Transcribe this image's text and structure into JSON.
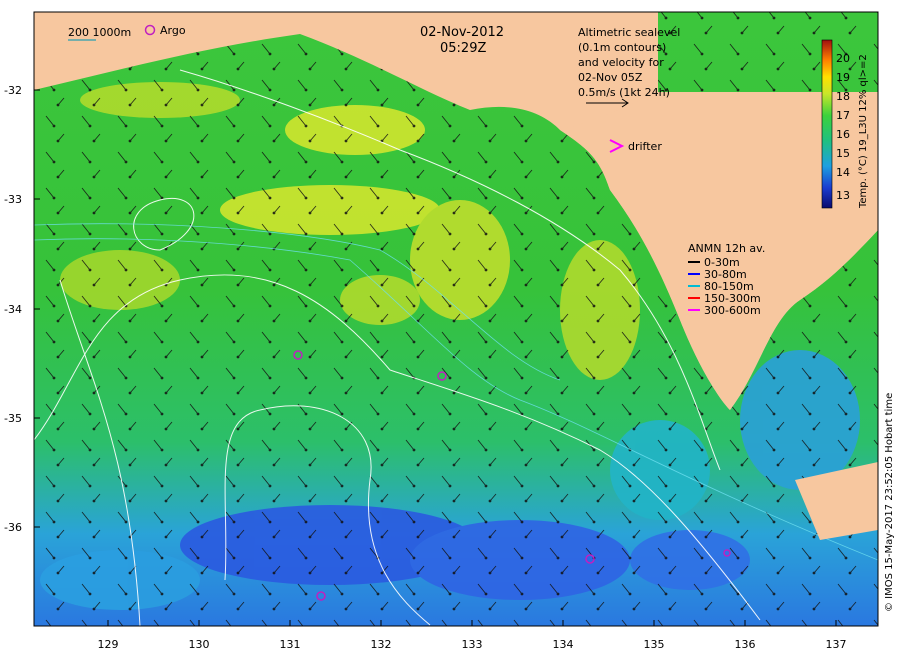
{
  "map": {
    "date": "02-Nov-2012",
    "time": "05:29Z",
    "scale_label": "200  1000m",
    "argo_label": "Argo",
    "altimetry_lines": [
      "Altimetric sealevel",
      "(0.1m contours)",
      "and velocity for",
      "02-Nov 05Z"
    ],
    "vector_scale_label": "0.5m/s (1kt 24h)",
    "drifter_label": "drifter",
    "credit": "© IMOS 15-May-2017 23:52:05 Hobart time",
    "y_ticks": [
      "-32",
      "-33",
      "-34",
      "-35",
      "-36"
    ],
    "x_ticks": [
      "129",
      "130",
      "131",
      "132",
      "133",
      "134",
      "135",
      "136",
      "137"
    ],
    "colorbar": {
      "title": "Temp. (°C) 19_L3U 12% ql>=2",
      "ticks": [
        "20",
        "19",
        "18",
        "17",
        "16",
        "15",
        "14",
        "13"
      ]
    },
    "anmn_legend": {
      "title": "ANMN 12h av.",
      "items": [
        {
          "label": "0-30m",
          "color": "#000000"
        },
        {
          "label": "30-80m",
          "color": "#0000ff"
        },
        {
          "label": "80-150m",
          "color": "#00bcd4"
        },
        {
          "label": "150-300m",
          "color": "#ff0000"
        },
        {
          "label": "300-600m",
          "color": "#ff00ff"
        }
      ]
    },
    "colors": {
      "land": "#f7c79f",
      "argo": "#c020c0",
      "drifter": "#ff00ff",
      "contour": "#ffffff"
    }
  }
}
